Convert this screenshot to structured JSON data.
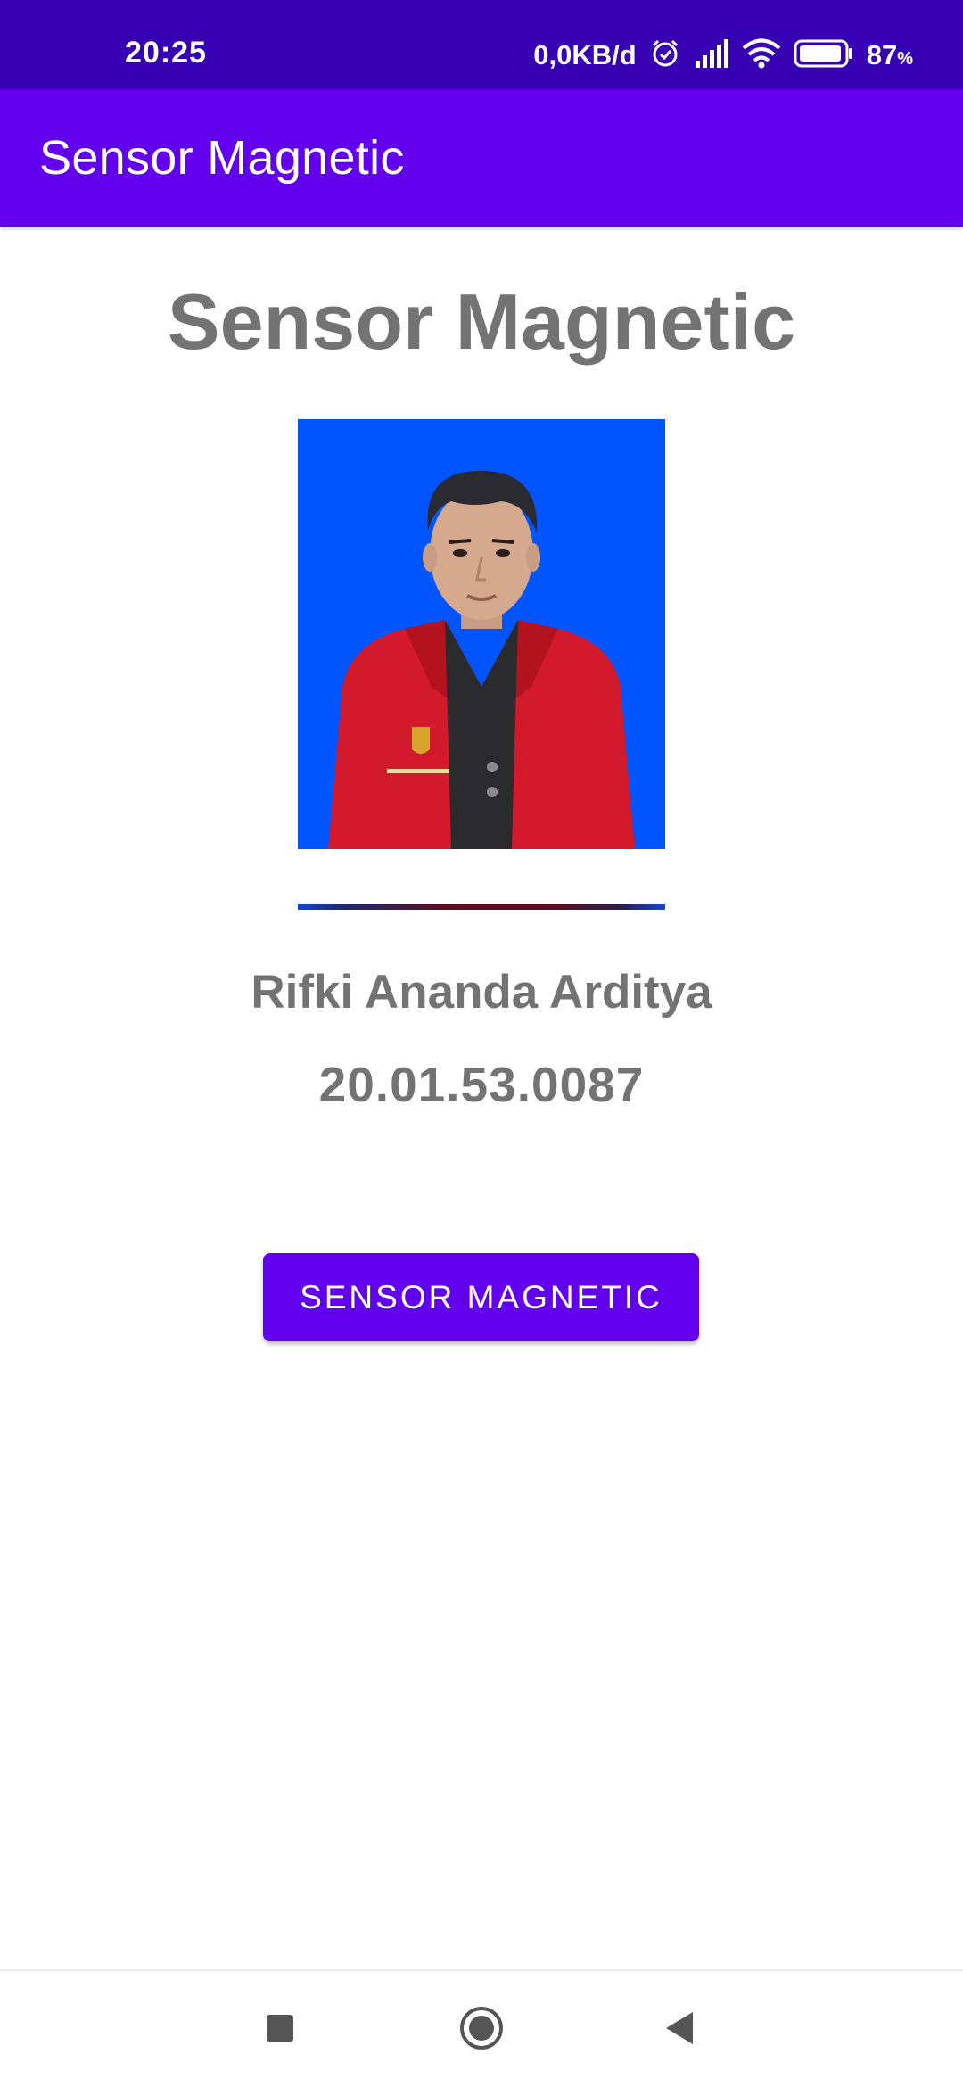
{
  "status_bar": {
    "time": "20:25",
    "network_speed": "0,0KB/d",
    "battery_percent": "87",
    "battery_unit": "%",
    "icons": [
      "alarm-icon",
      "signal-icon",
      "wifi-icon",
      "battery-icon"
    ]
  },
  "app_bar": {
    "title": "Sensor Magnetic"
  },
  "main": {
    "heading": "Sensor Magnetic",
    "photo": {
      "background_color": "#0055ff",
      "jacket_color": "#d31a2c"
    },
    "student_name": "Rifki Ananda Arditya",
    "student_id": "20.01.53.0087",
    "button_label": "SENSOR MAGNETIC"
  },
  "nav_bar": {
    "icons": [
      "recents-icon",
      "home-icon",
      "back-icon"
    ]
  },
  "colors": {
    "status_bar": "#3700b3",
    "primary": "#6200ee",
    "text_gray": "#737373",
    "background": "#ffffff"
  }
}
